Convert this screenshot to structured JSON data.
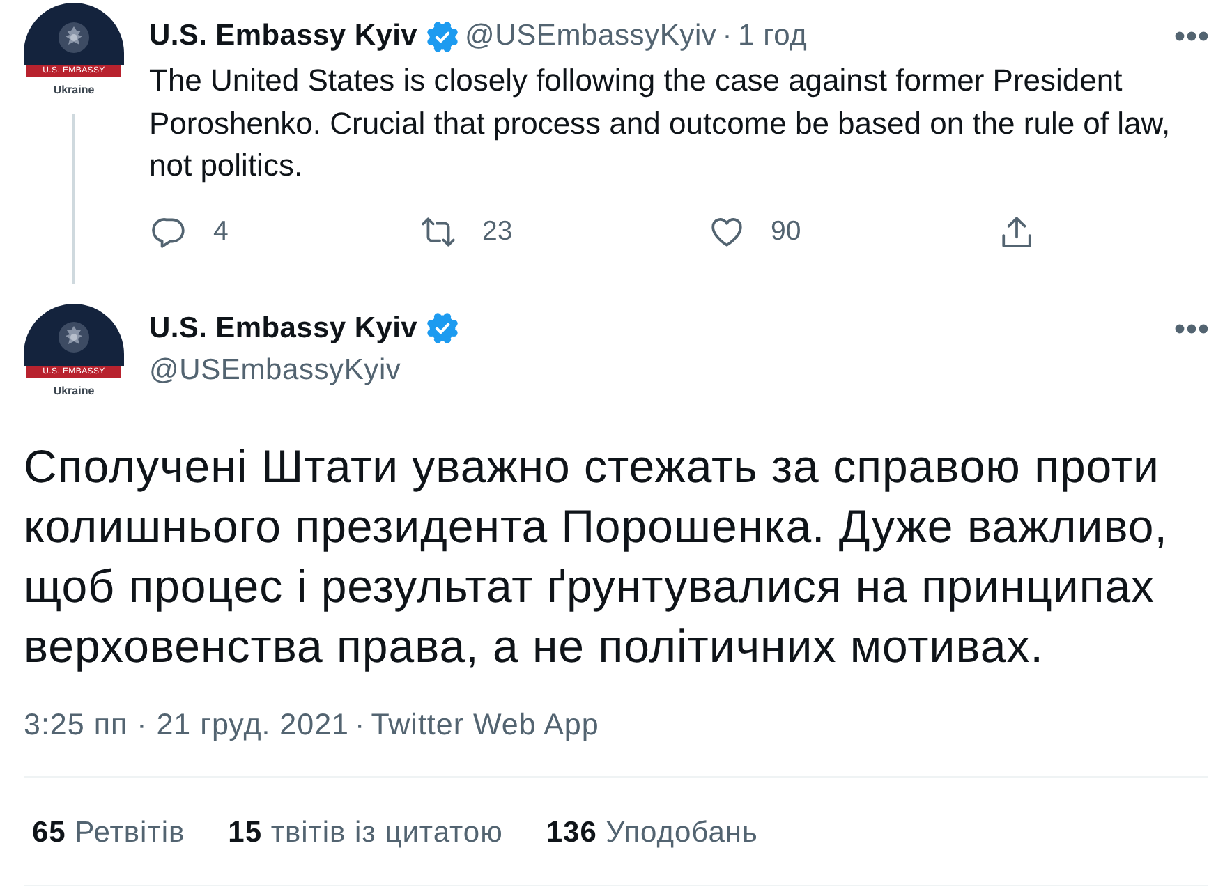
{
  "thread_tweet": {
    "avatar": {
      "banner": "U.S. EMBASSY",
      "caption": "Ukraine"
    },
    "name": "U.S. Embassy Kyiv",
    "verified": true,
    "handle": "@USEmbassyKyiv",
    "separator": "·",
    "time": "1 год",
    "text": "The United States is closely following the case against former President Poroshenko. Crucial that process and outcome be based on the rule of law, not politics.",
    "actions": [
      {
        "kind": "reply",
        "count": "4"
      },
      {
        "kind": "retweet",
        "count": "23"
      },
      {
        "kind": "like",
        "count": "90"
      },
      {
        "kind": "share"
      }
    ]
  },
  "main_tweet": {
    "avatar": {
      "banner": "U.S. EMBASSY",
      "caption": "Ukraine"
    },
    "name": "U.S. Embassy Kyiv",
    "verified": true,
    "handle": "@USEmbassyKyiv",
    "text": "Сполучені Штати уважно стежать за справою проти колишнього президента Порошенка. Дуже важливо, щоб процес і результат ґрунтувалися на принципах верховенства права, а не політичних мотивах.",
    "timestamp": "3:25 пп · 21 груд. 2021",
    "separator": "·",
    "source": "Twitter Web App",
    "stats": [
      {
        "count": "65",
        "label": "Ретвітів"
      },
      {
        "count": "15",
        "label": "твітів із цитатою"
      },
      {
        "count": "136",
        "label": "Уподобань"
      }
    ]
  }
}
